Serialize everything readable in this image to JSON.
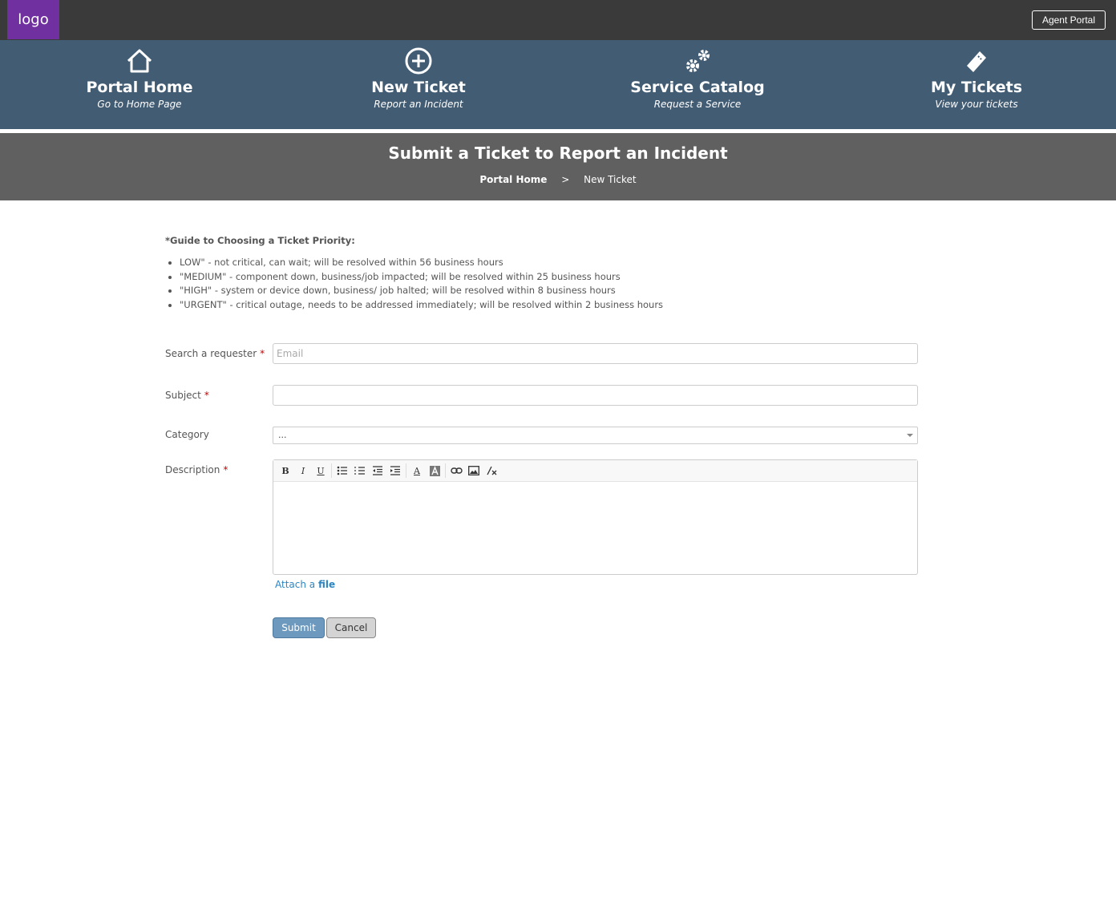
{
  "header": {
    "logo_text": "logo",
    "agent_portal_label": "Agent Portal"
  },
  "nav": {
    "items": [
      {
        "icon": "home-icon",
        "title": "Portal Home",
        "subtitle": "Go to Home Page"
      },
      {
        "icon": "plus-circle-icon",
        "title": "New Ticket",
        "subtitle": "Report an Incident"
      },
      {
        "icon": "gears-icon",
        "title": "Service Catalog",
        "subtitle": "Request a Service"
      },
      {
        "icon": "ticket-icon",
        "title": "My Tickets",
        "subtitle": "View your tickets"
      }
    ]
  },
  "hero": {
    "title": "Submit a Ticket to Report an Incident",
    "breadcrumb_home": "Portal Home",
    "breadcrumb_sep": ">",
    "breadcrumb_current": "New Ticket"
  },
  "guide": {
    "title": "*Guide to Choosing a Ticket Priority:",
    "items": [
      "LOW\" - not critical, can wait; will be resolved within 56 business hours",
      "\"MEDIUM\" - component down, business/job impacted; will be resolved within 25 business hours",
      "\"HIGH\" - system or device down, business/ job halted; will be resolved within 8 business hours",
      "\"URGENT\" - critical outage, needs to be addressed immediately; will be resolved within 2 business hours"
    ]
  },
  "form": {
    "requester_label": "Search a requester",
    "requester_placeholder": "Email",
    "subject_label": "Subject",
    "subject_value": "",
    "category_label": "Category",
    "category_value": "...",
    "description_label": "Description",
    "required_mark": "*",
    "attach_prefix": "Attach a",
    "attach_link": "file",
    "submit_label": "Submit",
    "cancel_label": "Cancel"
  },
  "editor_toolbar": {
    "bold": "B",
    "italic": "I",
    "underline": "U",
    "font_color": "A"
  },
  "colors": {
    "topbar": "#3a3a3a",
    "logo": "#7030a0",
    "nav": "#425c74",
    "hero": "#606060",
    "submit": "#6d99bf",
    "link": "#2e86c1",
    "required": "#cc0000"
  }
}
